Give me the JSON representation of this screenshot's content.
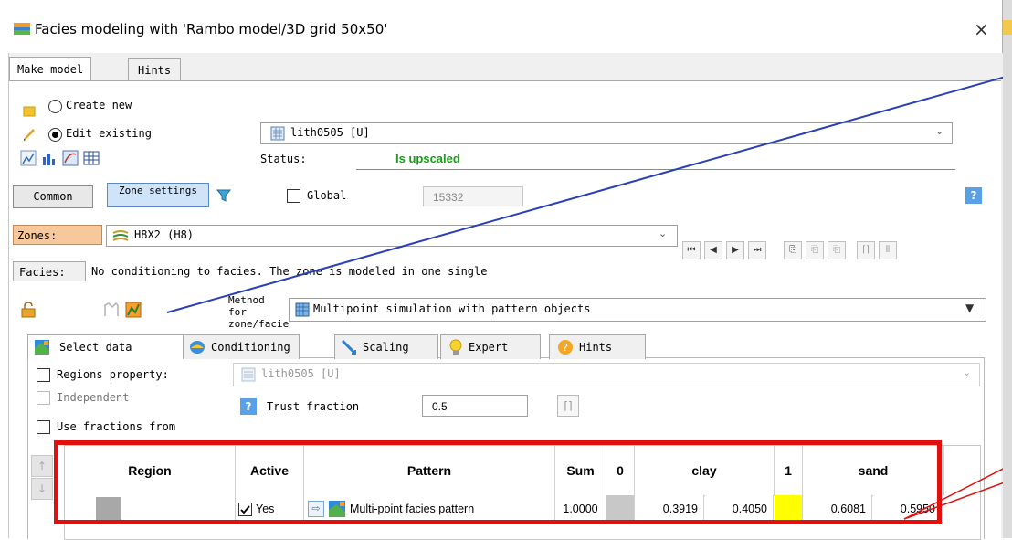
{
  "window": {
    "title": "Facies modeling with 'Rambo model/3D grid 50x50'",
    "close_glyph": "×"
  },
  "tabs": [
    "Make model",
    "Hints"
  ],
  "mode": {
    "create_new_label": "Create new",
    "edit_existing_label": "Edit existing",
    "selected": "edit_existing"
  },
  "property_select": {
    "value": "lith0505 [U]"
  },
  "status": {
    "label": "Status:",
    "value": "Is upscaled",
    "value_color": "#1a9a1a"
  },
  "settings_tabs": {
    "common_label": "Common",
    "zone_settings_label": "Zone settings"
  },
  "global": {
    "label": "Global",
    "value": "15332",
    "checked": false
  },
  "zones": {
    "label": "Zones:",
    "value": "H8X2 (H8)"
  },
  "facies": {
    "label": "Facies:",
    "text": "No conditioning to facies. The zone is modeled in one single"
  },
  "method": {
    "label": "Method for zone/facie",
    "value": "Multipoint simulation with pattern objects"
  },
  "subtabs": [
    "Select data",
    "Conditioning",
    "Scaling",
    "Expert",
    "Hints"
  ],
  "regions_property": {
    "label": "Regions property:",
    "value": "lith0505 [U]",
    "checked": false
  },
  "independent": {
    "label": "Independent",
    "checked": false
  },
  "trust_fraction": {
    "label": "Trust fraction",
    "value": "0.5"
  },
  "use_fractions": {
    "label": "Use fractions from",
    "checked": false
  },
  "table": {
    "headers": [
      "Region",
      "Active",
      "Pattern",
      "Sum",
      "0",
      "clay",
      "1",
      "sand"
    ],
    "rows": [
      {
        "region": "",
        "active_checked": true,
        "active": "Yes",
        "pattern": "Multi-point facies pattern",
        "sum": "1.0000",
        "clay_a": "0.3919",
        "clay_b": "0.4050",
        "sand_a": "0.6081",
        "sand_b": "0.5950",
        "color_0": "#c0c0c0",
        "color_1": "#ffff00"
      }
    ]
  },
  "colors": {
    "annotation": "#e01010",
    "arrow_line": "#2a3fb8",
    "selected_tab_fill": "#ffffff"
  }
}
